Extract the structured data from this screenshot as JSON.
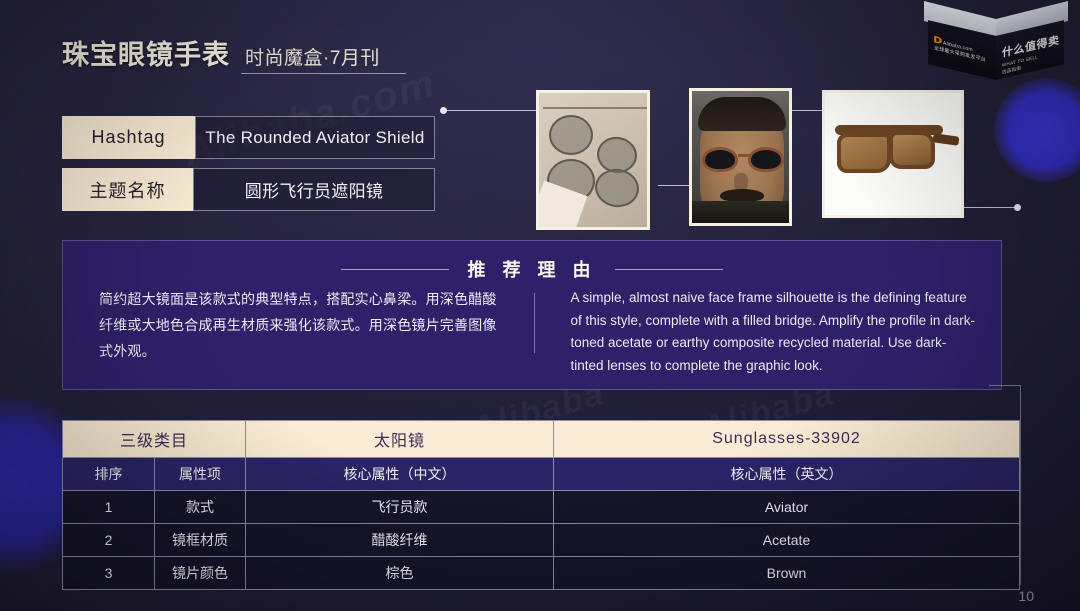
{
  "slide": {
    "page_number": "10",
    "background_color": "#24213c",
    "accent_cream": "#faecd4",
    "accent_purple": "#2e2069"
  },
  "header": {
    "title": "珠宝眼镜手表",
    "subtitle": "时尚魔盒·7月刊"
  },
  "logo_box": {
    "brand_latin": "Alibaba.com",
    "brand_sub": "全球最大采购批发平台",
    "brand_cn_small": "阿里巴巴国际站",
    "slogan_cn": "什么值得卖",
    "slogan_en": "WHAT TO SELL",
    "slogan_sub": "选品指南"
  },
  "info_rows": [
    {
      "key": "Hashtag",
      "value": "The Rounded Aviator Shield"
    },
    {
      "key": "主题名称",
      "value": "圆形飞行员遮阳镜"
    }
  ],
  "photos": [
    {
      "name": "hanging-aviator-sunglasses-pair"
    },
    {
      "name": "man-wearing-tortoiseshell-aviators"
    },
    {
      "name": "brown-acetate-shield-sunglasses"
    }
  ],
  "recommendation": {
    "title": "推 荐 理 由",
    "text_cn": "简约超大镜面是该款式的典型特点，搭配实心鼻梁。用深色醋酸纤维或大地色合成再生材质来强化该款式。用深色镜片完善图像式外观。",
    "text_en": "A simple, almost naive face frame silhouette is the defining feature of this style, complete with a filled bridge. Amplify the profile in dark-toned acetate or earthy composite recycled material. Use dark- tinted lenses to complete the graphic look."
  },
  "table": {
    "top_header": {
      "category_label": "三级类目",
      "category_cn": "太阳镜",
      "category_en": "Sunglasses-33902"
    },
    "column_headers": [
      "排序",
      "属性项",
      "核心属性（中文）",
      "核心属性（英文）"
    ],
    "rows": [
      {
        "order": "1",
        "attribute": "款式",
        "value_cn": "飞行员款",
        "value_en": "Aviator"
      },
      {
        "order": "2",
        "attribute": "镜框材质",
        "value_cn": "醋酸纤维",
        "value_en": "Acetate"
      },
      {
        "order": "3",
        "attribute": "镜片颜色",
        "value_cn": "棕色",
        "value_en": "Brown"
      }
    ]
  },
  "watermarks": {
    "a": "Alibaba.com",
    "b": "Alibaba",
    "c": "Alibaba"
  }
}
